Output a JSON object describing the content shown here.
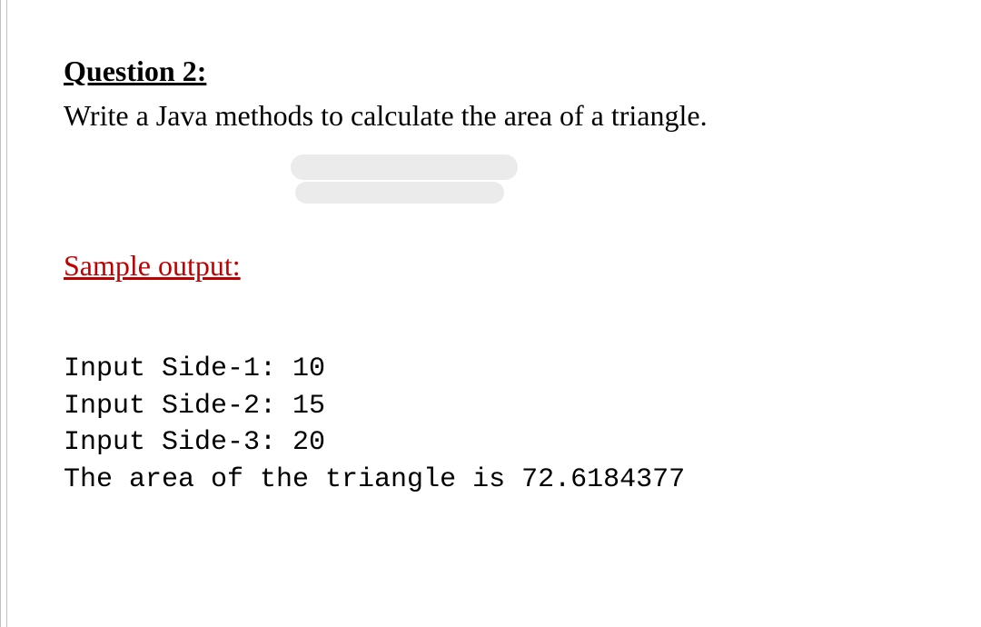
{
  "question": {
    "heading": "Question 2:",
    "text": "Write a Java methods to calculate the area of a triangle."
  },
  "sample": {
    "heading": "Sample output:",
    "lines": [
      "Input Side-1: 10",
      "Input Side-2: 15",
      "Input Side-3: 20",
      "The area of the triangle is 72.6184377"
    ]
  }
}
